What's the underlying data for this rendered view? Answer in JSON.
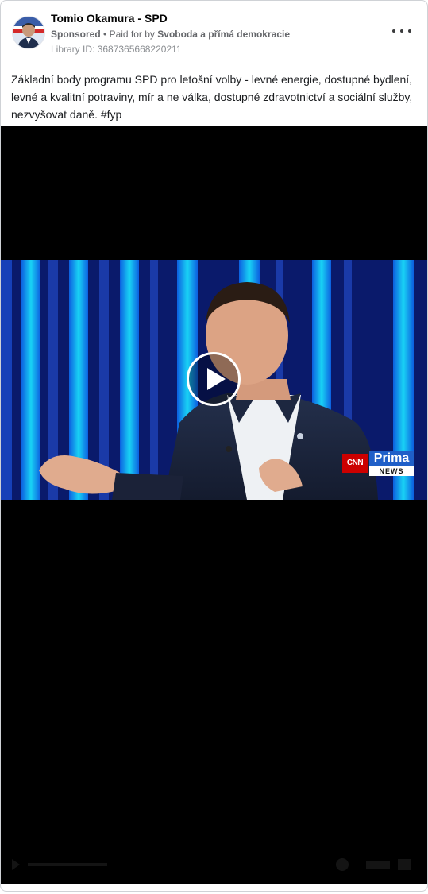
{
  "post": {
    "page_name": "Tomio Okamura - SPD",
    "sponsored": "Sponsored",
    "separator": "•",
    "paid_for_prefix": "Paid for by",
    "paid_for_by": "Svoboda a přímá demokracie",
    "library_id": "Library ID: 3687365668220211",
    "caption": "Základní body programu SPD pro letošní volby - levné energie, dostupné bydlení, levné a kvalitní potraviny, mír a ne válka, dostupné zdravotnictví a sociální služby, nezvyšovat daně. #fyp"
  },
  "video": {
    "logo": {
      "cnn": "CNN",
      "prima": "Prima",
      "news": "NEWS"
    }
  },
  "icons": {
    "more": "more-options-icon",
    "play": "play-icon"
  },
  "colors": {
    "stage_background": "#0a1a6b",
    "stage_stripes": "#19d3f5",
    "prima_blue": "#1f5fc8",
    "cnn_red": "#cc0000"
  }
}
